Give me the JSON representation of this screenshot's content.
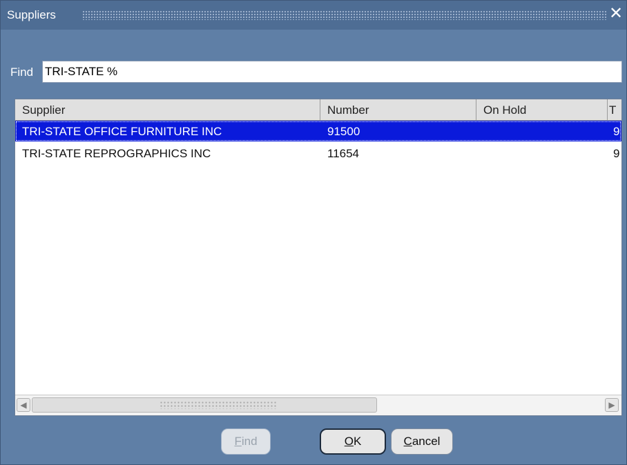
{
  "window": {
    "title": "Suppliers",
    "close_symbol": "✕"
  },
  "find": {
    "label": "Find",
    "value": "TRI-STATE %"
  },
  "table": {
    "columns": [
      "Supplier",
      "Number",
      "On Hold",
      "T"
    ],
    "rows": [
      {
        "supplier": "TRI-STATE OFFICE FURNITURE INC",
        "number": "91500",
        "on_hold": "",
        "extra": "9",
        "selected": true
      },
      {
        "supplier": "TRI-STATE REPROGRAPHICS INC",
        "number": "11654",
        "on_hold": "",
        "extra": "9",
        "selected": false
      }
    ]
  },
  "scrollbar": {
    "left_arrow": "◀",
    "right_arrow": "▶"
  },
  "buttons": {
    "find_mnemonic": "F",
    "find_rest": "ind",
    "ok_mnemonic": "O",
    "ok_rest": "K",
    "cancel_mnemonic": "C",
    "cancel_rest": "ancel"
  },
  "colors": {
    "dialog_bg": "#5f7fa6",
    "selection": "#0a1adb"
  }
}
